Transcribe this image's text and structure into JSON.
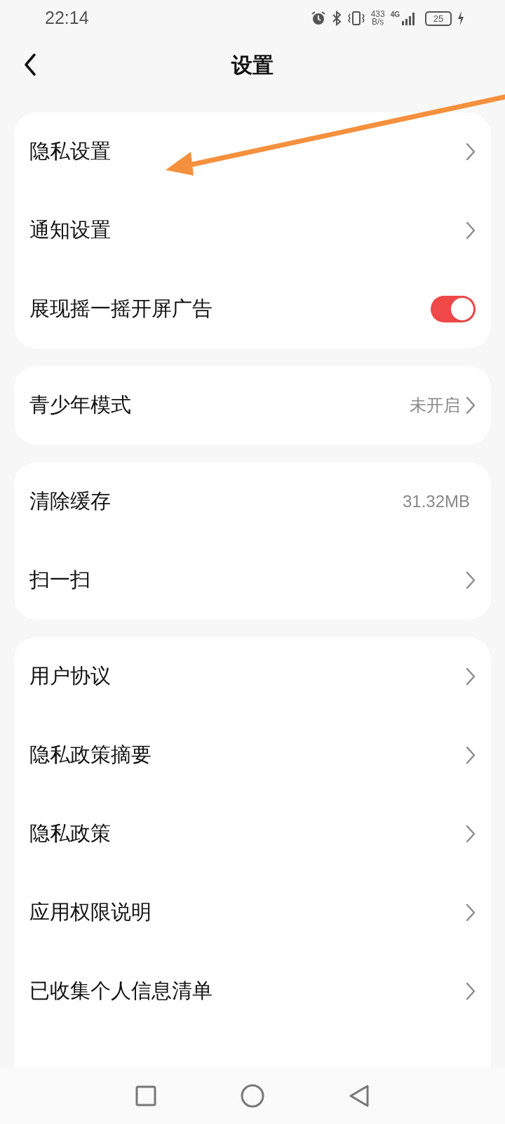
{
  "status_bar": {
    "time": "22:14",
    "speed_value": "433",
    "speed_unit": "B/s",
    "network": "4G",
    "battery": "25"
  },
  "header": {
    "title": "设置"
  },
  "groups": [
    {
      "items": [
        {
          "kind": "link",
          "label": "隐私设置"
        },
        {
          "kind": "link",
          "label": "通知设置"
        },
        {
          "kind": "toggle",
          "label": "展现摇一摇开屏广告",
          "on": true
        }
      ]
    },
    {
      "items": [
        {
          "kind": "link",
          "label": "青少年模式",
          "value": "未开启"
        }
      ]
    },
    {
      "items": [
        {
          "kind": "value",
          "label": "清除缓存",
          "value": "31.32MB"
        },
        {
          "kind": "link",
          "label": "扫一扫"
        }
      ]
    },
    {
      "items": [
        {
          "kind": "link",
          "label": "用户协议"
        },
        {
          "kind": "link",
          "label": "隐私政策摘要"
        },
        {
          "kind": "link",
          "label": "隐私政策"
        },
        {
          "kind": "link",
          "label": "应用权限说明"
        },
        {
          "kind": "link",
          "label": "已收集个人信息清单"
        }
      ]
    }
  ]
}
